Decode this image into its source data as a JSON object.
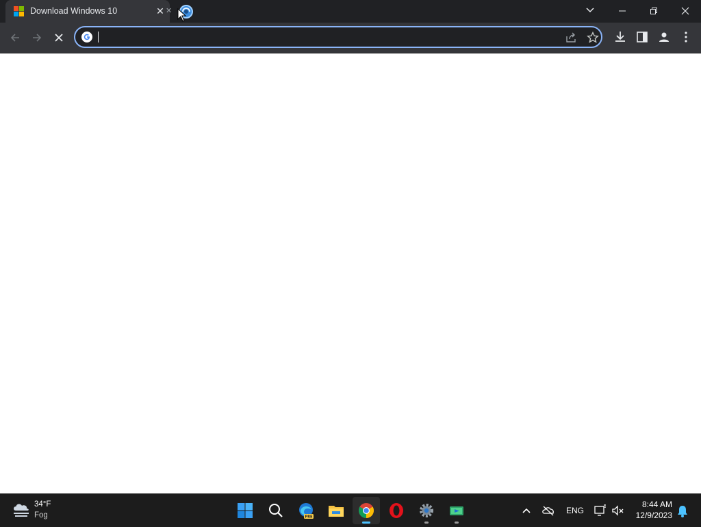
{
  "browser": {
    "tabs": [
      {
        "title": "Download Windows 10",
        "active": true,
        "icon": "windows-logo-icon"
      },
      {
        "title": "",
        "active": false,
        "icon": "loading-globe-icon"
      }
    ],
    "window_controls": {
      "tab_search": "chevron-down-icon",
      "minimize": "minimize-icon",
      "restore": "restore-icon",
      "close": "close-icon"
    },
    "toolbar": {
      "back": "back-arrow-icon",
      "forward": "forward-arrow-icon",
      "stop": "stop-loading-icon",
      "address_value": "",
      "address_placeholder": "",
      "site_icon": "google-g-icon",
      "share": "share-icon",
      "bookmark": "star-icon",
      "download": "download-icon",
      "side_panel": "side-panel-icon",
      "profile": "profile-icon",
      "menu": "kebab-menu-icon"
    },
    "accent_color": "#8ab4f8"
  },
  "taskbar": {
    "weather": {
      "temp": "34°F",
      "condition": "Fog",
      "icon": "fog-cloud-icon"
    },
    "apps": [
      {
        "name": "start",
        "icon": "windows-start-icon"
      },
      {
        "name": "search",
        "icon": "search-icon"
      },
      {
        "name": "edge-preview",
        "icon": "edge-pre-icon"
      },
      {
        "name": "file-explorer",
        "icon": "folder-icon"
      },
      {
        "name": "chrome",
        "icon": "chrome-icon",
        "active": true
      },
      {
        "name": "opera",
        "icon": "opera-icon"
      },
      {
        "name": "settings",
        "icon": "gear-icon"
      },
      {
        "name": "app",
        "icon": "green-app-icon"
      }
    ],
    "tray": {
      "language": "ENG",
      "time": "8:44 AM",
      "date": "12/9/2023"
    }
  }
}
